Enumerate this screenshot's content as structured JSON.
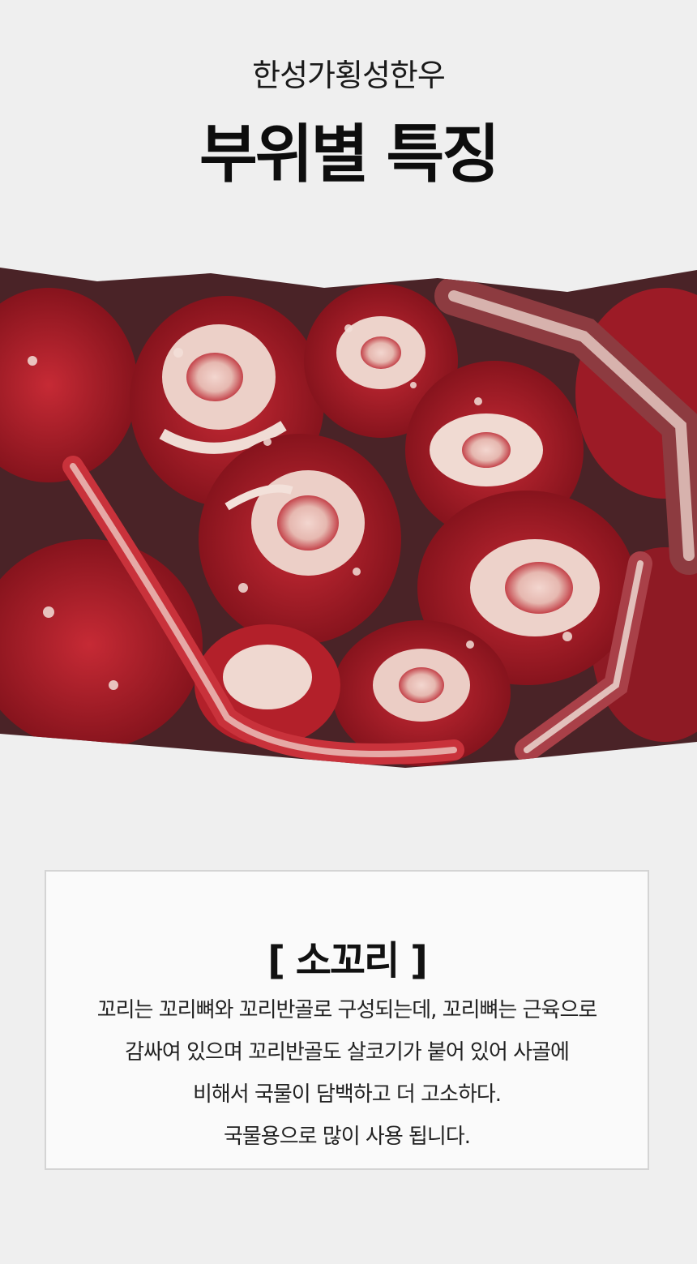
{
  "header": {
    "brand": "한성가횡성한우",
    "title": "부위별 특징"
  },
  "photo": {
    "subject": "oxtail-cuts",
    "colors": {
      "meat": "#b3202a",
      "meat_dark": "#7a0f18",
      "fat": "#f1dcd6",
      "bone": "#e7c9c0",
      "shadow": "#3a1f22"
    }
  },
  "info": {
    "part_name": "[ 소꼬리 ]",
    "lines": [
      "꼬리는 꼬리뼈와 꼬리반골로 구성되는데, 꼬리뼈는 근육으로",
      "감싸여 있으며 꼬리반골도 살코기가 붙어 있어 사골에",
      "비해서 국물이 담백하고 더 고소하다.",
      "국물용으로 많이 사용 됩니다."
    ]
  }
}
